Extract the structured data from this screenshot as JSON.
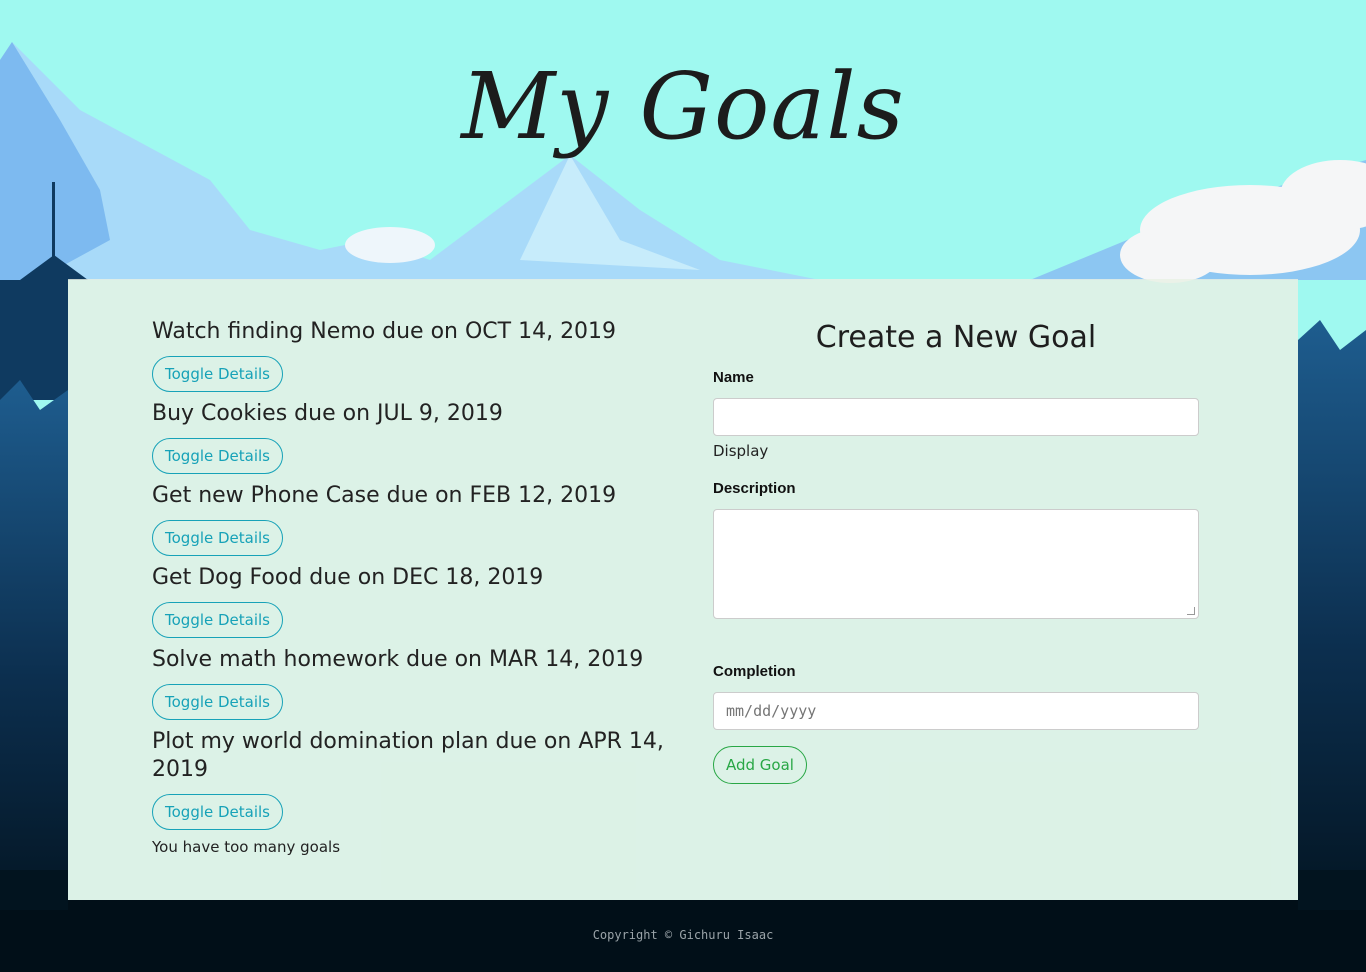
{
  "header": {
    "title": "My Goals"
  },
  "goals": [
    {
      "title": "Watch finding Nemo due on OCT 14, 2019",
      "toggle_label": "Toggle Details"
    },
    {
      "title": "Buy Cookies due on JUL 9, 2019",
      "toggle_label": "Toggle Details"
    },
    {
      "title": "Get new Phone Case due on FEB 12, 2019",
      "toggle_label": "Toggle Details"
    },
    {
      "title": "Get Dog Food due on DEC 18, 2019",
      "toggle_label": "Toggle Details"
    },
    {
      "title": "Solve math homework due on MAR 14, 2019",
      "toggle_label": "Toggle Details"
    },
    {
      "title": "Plot my world domination plan due on APR 14, 2019",
      "toggle_label": "Toggle Details"
    }
  ],
  "goals_message": "You have too many goals",
  "form": {
    "title": "Create a New Goal",
    "name_label": "Name",
    "name_value": "",
    "name_hint": "Display",
    "description_label": "Description",
    "description_value": "",
    "completion_label": "Completion",
    "completion_placeholder": "mm/dd/yyyy",
    "submit_label": "Add Goal"
  },
  "footer": {
    "copyright": "Copyright © Gichuru Isaac"
  },
  "colors": {
    "sky": "#9ff9f0",
    "mountain_light": "#a9dcfa",
    "mountain_mid": "#77b9f0",
    "forest_dark": "#0d2f4f",
    "ground": "#000f17",
    "toggle_accent": "#17a2b8",
    "add_accent": "#28a745"
  }
}
